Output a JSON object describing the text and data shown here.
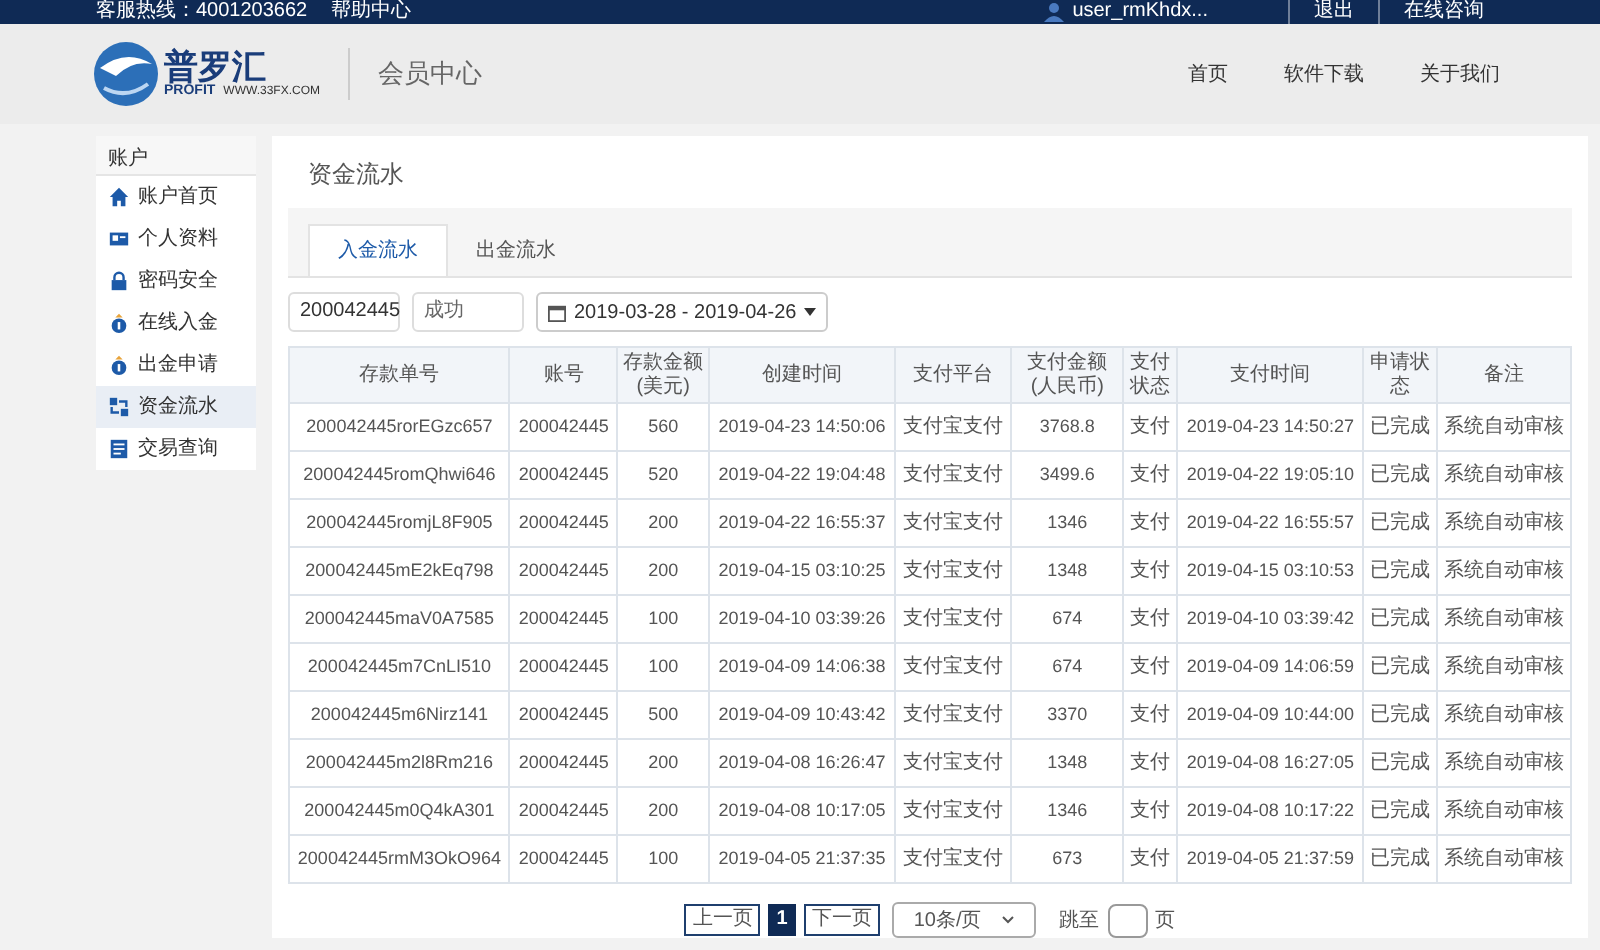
{
  "top_bar": {
    "hotline": "客服热线：4001203662",
    "help": "帮助中心",
    "user": "user_rmKhdx...",
    "logout": "退出",
    "consult": "在线咨询"
  },
  "header": {
    "logo": {
      "badge": "PROFIT",
      "name": "普罗汇",
      "url": "WWW.33FX.COM"
    },
    "section": "会员中心",
    "nav": [
      "首页",
      "软件下载",
      "关于我们"
    ]
  },
  "sidebar": {
    "title": "账户",
    "items": [
      {
        "kind": "home",
        "label": "账户首页",
        "selected": false
      },
      {
        "kind": "card",
        "label": "个人资料",
        "selected": false
      },
      {
        "kind": "lock",
        "label": "密码安全",
        "selected": false
      },
      {
        "kind": "bag",
        "label": "在线入金",
        "selected": false
      },
      {
        "kind": "bag",
        "label": "出金申请",
        "selected": false
      },
      {
        "kind": "flow",
        "label": "资金流水",
        "selected": true
      },
      {
        "kind": "ledger",
        "label": "交易查询",
        "selected": false
      }
    ]
  },
  "main": {
    "title": "资金流水",
    "tabs": [
      {
        "label": "入金流水",
        "selected": true
      },
      {
        "label": "出金流水",
        "selected": false
      }
    ],
    "filters": {
      "account": "200042445",
      "status": "成功",
      "date_range": "2019-03-28 - 2019-04-26"
    },
    "table": {
      "columns": [
        "存款单号",
        "账号",
        "存款金额(美元)",
        "创建时间",
        "支付平台",
        "支付金额(人民币)",
        "支付状态",
        "支付时间",
        "申请状态",
        "备注"
      ],
      "rows": [
        [
          "200042445rorEGzc657",
          "200042445",
          "560",
          "2019-04-23 14:50:06",
          "支付宝支付",
          "3768.8",
          "支付",
          "2019-04-23 14:50:27",
          "已完成",
          "系统自动审核"
        ],
        [
          "200042445romQhwi646",
          "200042445",
          "520",
          "2019-04-22 19:04:48",
          "支付宝支付",
          "3499.6",
          "支付",
          "2019-04-22 19:05:10",
          "已完成",
          "系统自动审核"
        ],
        [
          "200042445romjL8F905",
          "200042445",
          "200",
          "2019-04-22 16:55:37",
          "支付宝支付",
          "1346",
          "支付",
          "2019-04-22 16:55:57",
          "已完成",
          "系统自动审核"
        ],
        [
          "200042445mE2kEq798",
          "200042445",
          "200",
          "2019-04-15 03:10:25",
          "支付宝支付",
          "1348",
          "支付",
          "2019-04-15 03:10:53",
          "已完成",
          "系统自动审核"
        ],
        [
          "200042445maV0A7585",
          "200042445",
          "100",
          "2019-04-10 03:39:26",
          "支付宝支付",
          "674",
          "支付",
          "2019-04-10 03:39:42",
          "已完成",
          "系统自动审核"
        ],
        [
          "200042445m7CnLI510",
          "200042445",
          "100",
          "2019-04-09 14:06:38",
          "支付宝支付",
          "674",
          "支付",
          "2019-04-09 14:06:59",
          "已完成",
          "系统自动审核"
        ],
        [
          "200042445m6Nirz141",
          "200042445",
          "500",
          "2019-04-09 10:43:42",
          "支付宝支付",
          "3370",
          "支付",
          "2019-04-09 10:44:00",
          "已完成",
          "系统自动审核"
        ],
        [
          "200042445m2l8Rm216",
          "200042445",
          "200",
          "2019-04-08 16:26:47",
          "支付宝支付",
          "1348",
          "支付",
          "2019-04-08 16:27:05",
          "已完成",
          "系统自动审核"
        ],
        [
          "200042445m0Q4kA301",
          "200042445",
          "200",
          "2019-04-08 10:17:05",
          "支付宝支付",
          "1346",
          "支付",
          "2019-04-08 10:17:22",
          "已完成",
          "系统自动审核"
        ],
        [
          "200042445rmM3OkO964",
          "200042445",
          "100",
          "2019-04-05 21:37:35",
          "支付宝支付",
          "673",
          "支付",
          "2019-04-05 21:37:59",
          "已完成",
          "系统自动审核"
        ]
      ]
    },
    "pagination": {
      "prev": "上一页",
      "pages": [
        {
          "label": "1",
          "selected": true
        }
      ],
      "next": "下一页",
      "page_size": "10条/页",
      "jump_label": "跳至",
      "page_suffix": "页"
    }
  }
}
